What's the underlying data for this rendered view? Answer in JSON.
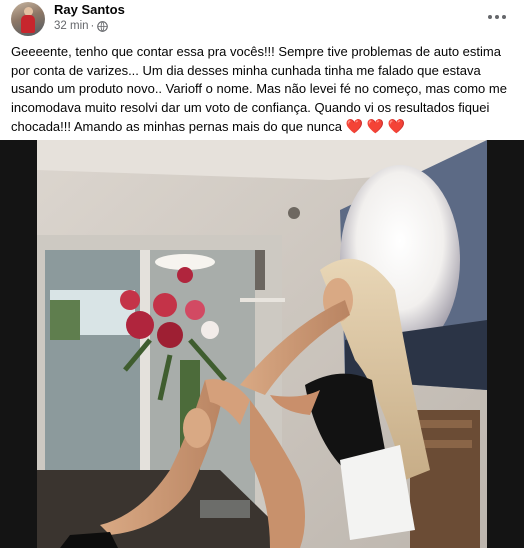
{
  "post": {
    "author": "Ray Santos",
    "time": "32 min",
    "separator": "·",
    "audience_icon": "globe-icon",
    "more_icon": "more-options-icon",
    "text": "Geeeente, tenho que contar essa pra vocês!!! Sempre tive problemas de auto estima por conta de varizes... Um dia desses minha cunhada tinha me falado que estava usando um produto novo.. Varioff o nome. Mas não levei fé no começo, mas como me incomodava muito resolvi dar um voto de confiança. Quando vi os resultados fiquei chocada!!! Amando as minhas pernas mais do que nunca",
    "hearts": [
      "❤️",
      "❤️",
      "❤️"
    ]
  },
  "colors": {
    "text": "#050505",
    "secondary_text": "#65676b",
    "heart": "#e8291c",
    "photo_frame": "#141414"
  }
}
